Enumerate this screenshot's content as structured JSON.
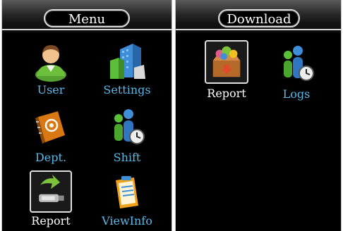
{
  "left_panel": {
    "title": "Menu",
    "items": [
      {
        "label": "User",
        "icon": "user-icon",
        "selected": false
      },
      {
        "label": "Settings",
        "icon": "buildings-icon",
        "selected": false
      },
      {
        "label": "Dept.",
        "icon": "address-book-icon",
        "selected": false
      },
      {
        "label": "Shift",
        "icon": "people-clock-icon",
        "selected": false
      },
      {
        "label": "Report",
        "icon": "usb-download-icon",
        "selected": true
      },
      {
        "label": "ViewInfo",
        "icon": "clipboard-icon",
        "selected": false
      }
    ]
  },
  "right_panel": {
    "title": "Download",
    "items": [
      {
        "label": "Report",
        "icon": "report-box-icon",
        "selected": true
      },
      {
        "label": "Logs",
        "icon": "people-clock-icon",
        "selected": false
      }
    ]
  },
  "colors": {
    "label_blue": "#5bb8e8",
    "selected_label": "#ffffff",
    "background": "#000000"
  }
}
